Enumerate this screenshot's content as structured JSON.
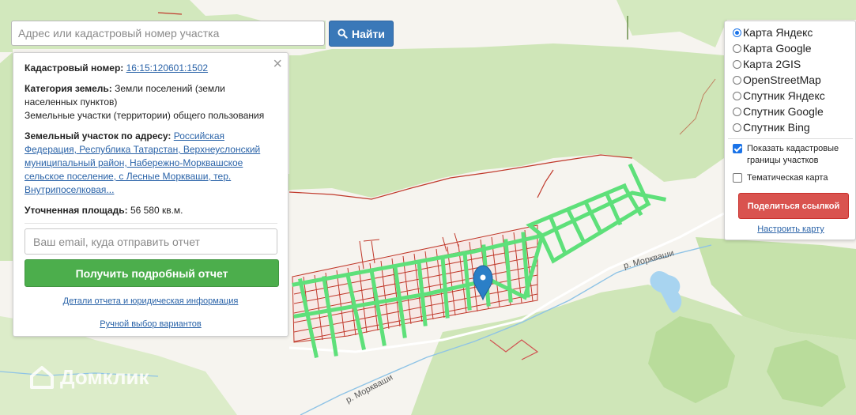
{
  "search": {
    "placeholder": "Адрес или кадастровый номер участка",
    "button_label": "Найти"
  },
  "info": {
    "cadastral_label": "Кадастровый номер:",
    "cadastral_number": "16:15:120601:1502",
    "category_label": "Категория земель:",
    "category_value": "Земли поселений (земли населенных пунктов)",
    "category_extra": "Земельные участки (территории) общего пользования",
    "address_label": "Земельный участок по адресу:",
    "address_value": "Российская Федерация, Республика Татарстан, Верхнеуслонский муниципальный район, Набережно-Морквашское сельское поселение, с Лесные Моркваши, тер. Внутрипоселковая...",
    "area_label": "Уточненная площадь:",
    "area_value": "56 580 кв.м.",
    "email_placeholder": "Ваш email, куда отправить отчет",
    "report_button": "Получить подробный отчет",
    "details_link": "Детали отчета и юридическая информация",
    "manual_link": "Ручной выбор вариантов"
  },
  "layers": {
    "options": [
      {
        "label": "Карта Яндекс",
        "selected": true
      },
      {
        "label": "Карта Google",
        "selected": false
      },
      {
        "label": "Карта 2GIS",
        "selected": false
      },
      {
        "label": "OpenStreetMap",
        "selected": false
      },
      {
        "label": "Спутник Яндекс",
        "selected": false
      },
      {
        "label": "Спутник Google",
        "selected": false
      },
      {
        "label": "Спутник Bing",
        "selected": false
      }
    ],
    "show_cadastral_label": "Показать кадастровые границы участков",
    "show_cadastral_checked": true,
    "thematic_label": "Тематическая карта",
    "thematic_checked": false,
    "share_button": "Поделиться ссылкой",
    "configure_link": "Настроить карту"
  },
  "map": {
    "river_label_1": "р. Моркваши",
    "river_label_2": "р. Моркваши",
    "watermark": "Домклик"
  },
  "colors": {
    "primary_button": "#3a78b8",
    "report_button": "#4cae4c",
    "share_button": "#d9534f",
    "forest": "#c9e3b0",
    "parcel_border": "#c0392b",
    "highlighted_parcel": "#5ee07a",
    "water": "#a8d4f0"
  }
}
